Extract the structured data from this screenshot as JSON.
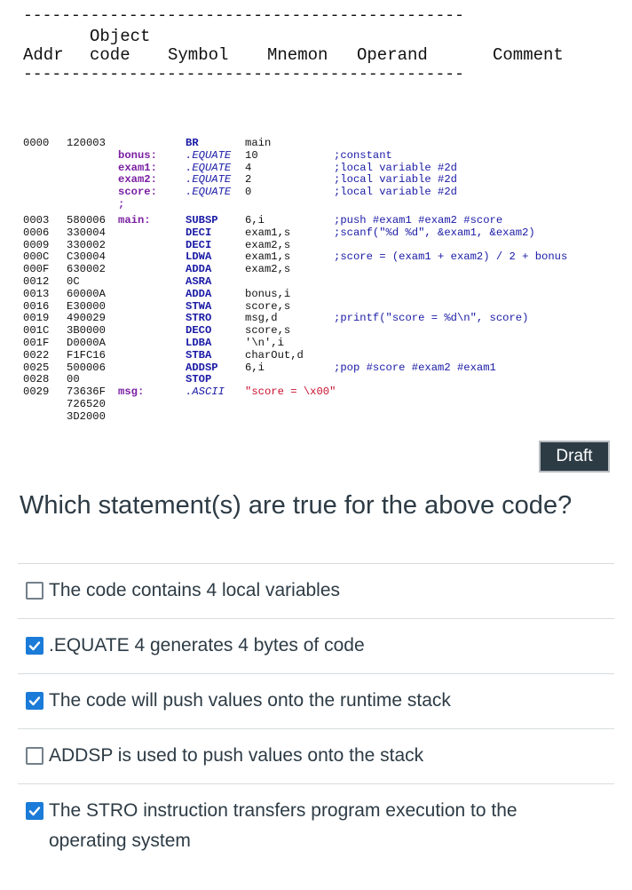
{
  "header": {
    "dash_line": "----------------------------------------------",
    "col_object": "Object",
    "col_addr": "Addr",
    "col_code": "code",
    "col_symbol": "Symbol",
    "col_mnemon": "Mnemon",
    "col_operand": "Operand",
    "col_comment": "Comment"
  },
  "listing": [
    {
      "addr": "0000",
      "code": "120003",
      "sym": "",
      "mne": "BR",
      "mne_italic": false,
      "opr": "main",
      "opr_str": false,
      "cmt": ""
    },
    {
      "addr": "",
      "code": "",
      "sym": "bonus:",
      "mne": ".EQUATE",
      "mne_italic": true,
      "opr": "10",
      "opr_str": false,
      "cmt": ";constant"
    },
    {
      "addr": "",
      "code": "",
      "sym": "exam1:",
      "mne": ".EQUATE",
      "mne_italic": true,
      "opr": "4",
      "opr_str": false,
      "cmt": ";local variable #2d"
    },
    {
      "addr": "",
      "code": "",
      "sym": "exam2:",
      "mne": ".EQUATE",
      "mne_italic": true,
      "opr": "2",
      "opr_str": false,
      "cmt": ";local variable #2d"
    },
    {
      "addr": "",
      "code": "",
      "sym": "score:",
      "mne": ".EQUATE",
      "mne_italic": true,
      "opr": "0",
      "opr_str": false,
      "cmt": ";local variable #2d"
    },
    {
      "addr": "",
      "code": "",
      "sym": ";",
      "mne": "",
      "mne_italic": false,
      "opr": "",
      "opr_str": false,
      "cmt": ""
    },
    {
      "addr": "0003",
      "code": "580006",
      "sym": "main:",
      "mne": "SUBSP",
      "mne_italic": false,
      "opr": "6,i",
      "opr_str": false,
      "cmt": ";push #exam1 #exam2 #score"
    },
    {
      "addr": "0006",
      "code": "330004",
      "sym": "",
      "mne": "DECI",
      "mne_italic": false,
      "opr": "exam1,s",
      "opr_str": false,
      "cmt": ";scanf(\"%d %d\", &exam1, &exam2)"
    },
    {
      "addr": "0009",
      "code": "330002",
      "sym": "",
      "mne": "DECI",
      "mne_italic": false,
      "opr": "exam2,s",
      "opr_str": false,
      "cmt": ""
    },
    {
      "addr": "000C",
      "code": "C30004",
      "sym": "",
      "mne": "LDWA",
      "mne_italic": false,
      "opr": "exam1,s",
      "opr_str": false,
      "cmt": ";score = (exam1 + exam2) / 2 + bonus"
    },
    {
      "addr": "000F",
      "code": "630002",
      "sym": "",
      "mne": "ADDA",
      "mne_italic": false,
      "opr": "exam2,s",
      "opr_str": false,
      "cmt": ""
    },
    {
      "addr": "0012",
      "code": "0C",
      "sym": "",
      "mne": "ASRA",
      "mne_italic": false,
      "opr": "",
      "opr_str": false,
      "cmt": ""
    },
    {
      "addr": "0013",
      "code": "60000A",
      "sym": "",
      "mne": "ADDA",
      "mne_italic": false,
      "opr": "bonus,i",
      "opr_str": false,
      "cmt": ""
    },
    {
      "addr": "0016",
      "code": "E30000",
      "sym": "",
      "mne": "STWA",
      "mne_italic": false,
      "opr": "score,s",
      "opr_str": false,
      "cmt": ""
    },
    {
      "addr": "0019",
      "code": "490029",
      "sym": "",
      "mne": "STRO",
      "mne_italic": false,
      "opr": "msg,d",
      "opr_str": false,
      "cmt": ";printf(\"score = %d\\n\", score)"
    },
    {
      "addr": "001C",
      "code": "3B0000",
      "sym": "",
      "mne": "DECO",
      "mne_italic": false,
      "opr": "score,s",
      "opr_str": false,
      "cmt": ""
    },
    {
      "addr": "001F",
      "code": "D0000A",
      "sym": "",
      "mne": "LDBA",
      "mne_italic": false,
      "opr": "'\\n',i",
      "opr_str": false,
      "cmt": ""
    },
    {
      "addr": "0022",
      "code": "F1FC16",
      "sym": "",
      "mne": "STBA",
      "mne_italic": false,
      "opr": "charOut,d",
      "opr_str": false,
      "cmt": ""
    },
    {
      "addr": "0025",
      "code": "500006",
      "sym": "",
      "mne": "ADDSP",
      "mne_italic": false,
      "opr": "6,i",
      "opr_str": false,
      "cmt": ";pop #score #exam2 #exam1"
    },
    {
      "addr": "0028",
      "code": "00",
      "sym": "",
      "mne": "STOP",
      "mne_italic": false,
      "opr": "",
      "opr_str": false,
      "cmt": ""
    },
    {
      "addr": "0029",
      "code": "73636F",
      "sym": "msg:",
      "mne": ".ASCII",
      "mne_italic": true,
      "opr": "\"score = \\x00\"",
      "opr_str": true,
      "cmt": ""
    },
    {
      "addr": "",
      "code": "726520",
      "sym": "",
      "mne": "",
      "mne_italic": false,
      "opr": "",
      "opr_str": false,
      "cmt": ""
    },
    {
      "addr": "",
      "code": "3D2000",
      "sym": "",
      "mne": "",
      "mne_italic": false,
      "opr": "",
      "opr_str": false,
      "cmt": ""
    }
  ],
  "draft_label": "Draft",
  "question": "Which statement(s) are true for the above code?",
  "options": [
    {
      "label": "The code contains 4 local variables",
      "checked": false
    },
    {
      "label": ".EQUATE 4 generates 4 bytes of code",
      "checked": true
    },
    {
      "label": "The code will push values onto the runtime stack",
      "checked": true
    },
    {
      "label": "ADDSP is used to push values onto the stack",
      "checked": false
    },
    {
      "label": "The STRO instruction transfers program execution to the operating system",
      "checked": true
    }
  ],
  "colors": {
    "accent": "#1b7bd8",
    "text": "#2d3b45",
    "symbol": "#7a1fa2",
    "mnemonic": "#1a1aa6",
    "string": "#c8102e"
  }
}
